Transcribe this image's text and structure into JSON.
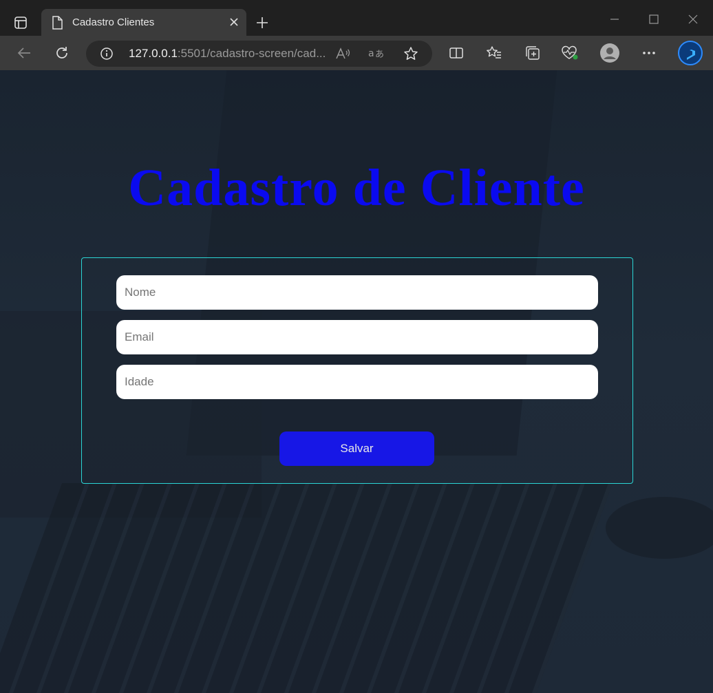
{
  "browser": {
    "tab_title": "Cadastro Clientes",
    "url_host": "127.0.0.1",
    "url_rest": ":5501/cadastro-screen/cad...",
    "icons": [
      "tab-actions-icon",
      "page-icon",
      "close-icon",
      "plus-icon",
      "minimize-icon",
      "maximize-icon",
      "close-window-icon",
      "back-icon",
      "refresh-icon",
      "info-icon",
      "read-aloud-icon",
      "translate-icon",
      "favorite-star-icon",
      "split-screen-icon",
      "favorites-icon",
      "collections-icon",
      "browser-essentials-icon",
      "profile-icon",
      "more-icon",
      "bing-icon"
    ]
  },
  "page": {
    "title": "Cadastro de Cliente",
    "title_color": "#0a0af0",
    "form": {
      "border_color": "#2bd6d6",
      "nome_placeholder": "Nome",
      "email_placeholder": "Email",
      "idade_placeholder": "Idade",
      "save_label": "Salvar",
      "save_color": "#1717e6"
    }
  }
}
